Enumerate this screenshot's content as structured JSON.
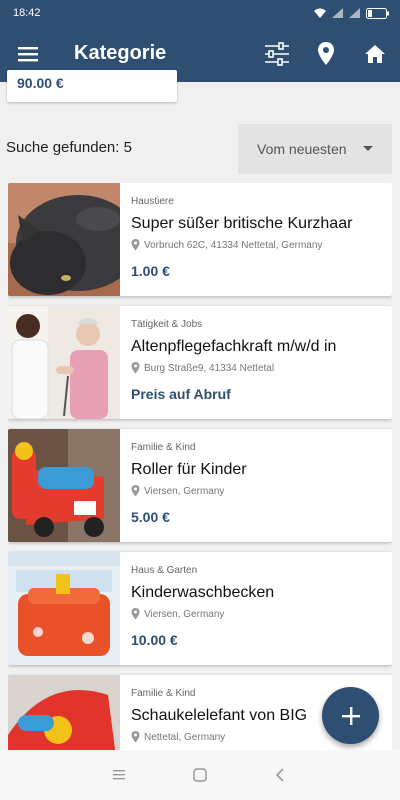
{
  "status_bar": {
    "time": "18:42"
  },
  "app_bar": {
    "title": "Kategorie"
  },
  "previous_card": {
    "price": "90.00 €"
  },
  "results": {
    "count_text": "Suche gefunden: 5"
  },
  "sort": {
    "selected": "Vom neuesten"
  },
  "listings": [
    {
      "category": "Haustiere",
      "title": "Super süßer britische Kurzhaar",
      "location": "Vorbruch 62C, 41334 Nettetal, Germany",
      "price": "1.00 €"
    },
    {
      "category": "Tätigkeit & Jobs",
      "title": "Altenpflegefachkraft m/w/d in",
      "location": "Burg Straße9, 41334 Nettetal",
      "price": "Preis auf Abruf"
    },
    {
      "category": "Familie & Kind",
      "title": "Roller für Kinder",
      "location": "Viersen, Germany",
      "price": "5.00 €"
    },
    {
      "category": "Haus & Garten",
      "title": "Kinderwaschbecken",
      "location": "Viersen, Germany",
      "price": "10.00 €"
    },
    {
      "category": "Familie & Kind",
      "title": "Schaukelelefant von BIG",
      "location": "Nettetal, Germany",
      "price": ""
    }
  ],
  "colors": {
    "primary": "#2f4f72",
    "background": "#f0f0f0"
  },
  "icons": [
    "menu-icon",
    "filter-sliders-icon",
    "location-pin-icon",
    "home-icon",
    "add-icon",
    "nav-recents-icon",
    "nav-home-icon",
    "nav-back-icon",
    "wifi-icon",
    "signal-icon",
    "battery-icon"
  ]
}
